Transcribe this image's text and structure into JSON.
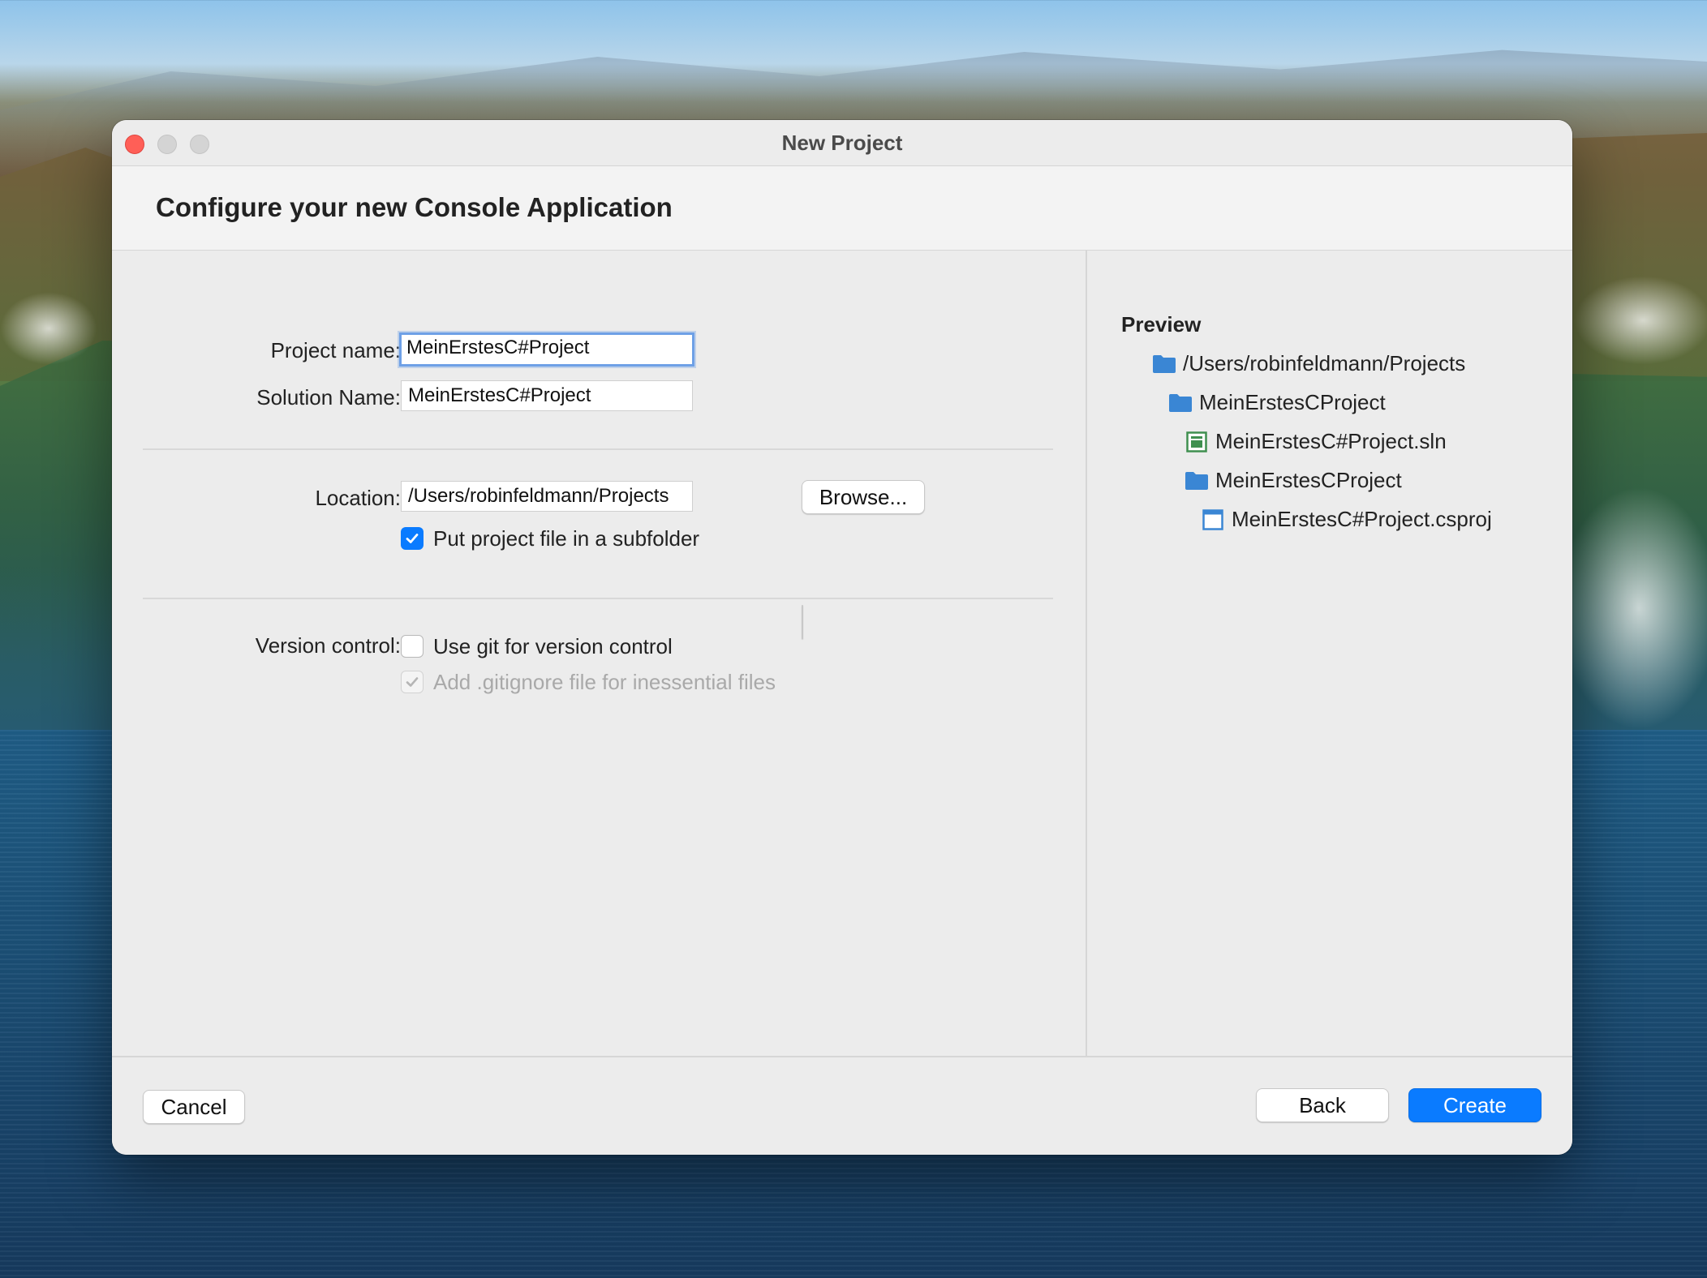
{
  "window": {
    "title": "New Project"
  },
  "header": {
    "title": "Configure your new Console Application"
  },
  "form": {
    "project_name_label": "Project name:",
    "project_name_value": "MeinErstesC#Project",
    "solution_name_label": "Solution Name:",
    "solution_name_value": "MeinErstesC#Project",
    "location_label": "Location:",
    "location_value": "/Users/robinfeldmann/Projects",
    "browse_label": "Browse...",
    "subfolder_label": "Put project file in a subfolder",
    "subfolder_checked": true,
    "version_control_label": "Version control:",
    "git_label": "Use git for version control",
    "git_checked": false,
    "gitignore_label": "Add .gitignore file for inessential files",
    "gitignore_checked": true,
    "gitignore_disabled": true
  },
  "preview": {
    "title": "Preview",
    "tree": [
      {
        "label": "/Users/robinfeldmann/Projects",
        "icon": "folder-icon"
      },
      {
        "label": "MeinErstesCProject",
        "icon": "folder-icon"
      },
      {
        "label": "MeinErstesC#Project.sln",
        "icon": "solution-file-icon"
      },
      {
        "label": "MeinErstesCProject",
        "icon": "folder-icon"
      },
      {
        "label": "MeinErstesC#Project.csproj",
        "icon": "project-file-icon"
      }
    ]
  },
  "footer": {
    "cancel_label": "Cancel",
    "back_label": "Back",
    "create_label": "Create"
  },
  "colors": {
    "accent": "#0a7bff",
    "folder": "#3a86d4",
    "solution": "#3f8f4f",
    "close": "#ff5f57"
  }
}
